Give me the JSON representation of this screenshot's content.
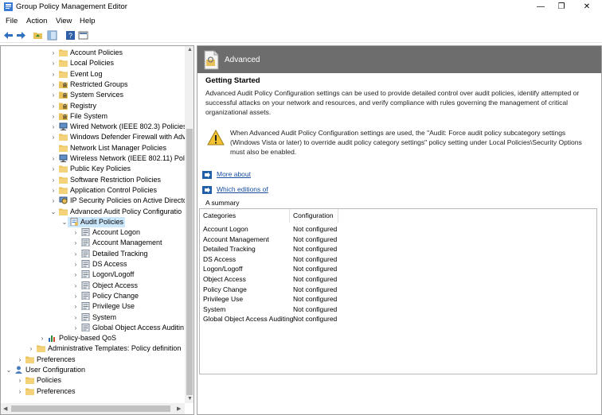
{
  "window": {
    "title": "Group Policy Management Editor"
  },
  "menu": [
    "File",
    "Action",
    "View",
    "Help"
  ],
  "tree": [
    {
      "label": "Account Policies",
      "level": 4,
      "icon": "folder-icon",
      "expander": "collapsed"
    },
    {
      "label": "Local Policies",
      "level": 4,
      "icon": "folder-icon",
      "expander": "collapsed"
    },
    {
      "label": "Event Log",
      "level": 4,
      "icon": "folder-icon",
      "expander": "collapsed"
    },
    {
      "label": "Restricted Groups",
      "level": 4,
      "icon": "folder-lock-icon",
      "expander": "collapsed"
    },
    {
      "label": "System Services",
      "level": 4,
      "icon": "folder-lock-icon",
      "expander": "collapsed"
    },
    {
      "label": "Registry",
      "level": 4,
      "icon": "folder-lock-icon",
      "expander": "collapsed"
    },
    {
      "label": "File System",
      "level": 4,
      "icon": "folder-lock-icon",
      "expander": "collapsed"
    },
    {
      "label": "Wired Network (IEEE 802.3) Policies",
      "level": 4,
      "icon": "network-icon",
      "expander": "collapsed"
    },
    {
      "label": "Windows Defender Firewall with Adv",
      "level": 4,
      "icon": "folder-icon",
      "expander": "collapsed"
    },
    {
      "label": "Network List Manager Policies",
      "level": 4,
      "icon": "folder-icon",
      "expander": "none"
    },
    {
      "label": "Wireless Network (IEEE 802.11) Polici",
      "level": 4,
      "icon": "network-icon",
      "expander": "collapsed"
    },
    {
      "label": "Public Key Policies",
      "level": 4,
      "icon": "folder-icon",
      "expander": "collapsed"
    },
    {
      "label": "Software Restriction Policies",
      "level": 4,
      "icon": "folder-icon",
      "expander": "collapsed"
    },
    {
      "label": "Application Control Policies",
      "level": 4,
      "icon": "folder-icon",
      "expander": "collapsed"
    },
    {
      "label": "IP Security Policies on Active Directo",
      "level": 4,
      "icon": "ip-security-icon",
      "expander": "collapsed"
    },
    {
      "label": "Advanced Audit Policy Configuratio",
      "level": 4,
      "icon": "folder-icon",
      "expander": "expanded"
    },
    {
      "label": "Audit Policies",
      "level": 5,
      "icon": "audit-icon",
      "expander": "expanded",
      "selected": true
    },
    {
      "label": "Account Logon",
      "level": 6,
      "icon": "policy-icon",
      "expander": "collapsed"
    },
    {
      "label": "Account Management",
      "level": 6,
      "icon": "policy-icon",
      "expander": "collapsed"
    },
    {
      "label": "Detailed Tracking",
      "level": 6,
      "icon": "policy-icon",
      "expander": "collapsed"
    },
    {
      "label": "DS Access",
      "level": 6,
      "icon": "policy-icon",
      "expander": "collapsed"
    },
    {
      "label": "Logon/Logoff",
      "level": 6,
      "icon": "policy-icon",
      "expander": "collapsed"
    },
    {
      "label": "Object Access",
      "level": 6,
      "icon": "policy-icon",
      "expander": "collapsed"
    },
    {
      "label": "Policy Change",
      "level": 6,
      "icon": "policy-icon",
      "expander": "collapsed"
    },
    {
      "label": "Privilege Use",
      "level": 6,
      "icon": "policy-icon",
      "expander": "collapsed"
    },
    {
      "label": "System",
      "level": 6,
      "icon": "policy-icon",
      "expander": "collapsed"
    },
    {
      "label": "Global Object Access Auditin",
      "level": 6,
      "icon": "policy-icon",
      "expander": "collapsed"
    },
    {
      "label": "Policy-based QoS",
      "level": 3,
      "icon": "chart-icon",
      "expander": "collapsed"
    },
    {
      "label": "Administrative Templates: Policy definition",
      "level": 2,
      "icon": "folder-icon",
      "expander": "collapsed"
    },
    {
      "label": "Preferences",
      "level": 1,
      "icon": "folder-icon",
      "expander": "collapsed"
    },
    {
      "label": "User Configuration",
      "level": 0,
      "icon": "user-config-icon",
      "expander": "expanded"
    },
    {
      "label": "Policies",
      "level": 1,
      "icon": "folder-icon",
      "expander": "collapsed"
    },
    {
      "label": "Preferences",
      "level": 1,
      "icon": "folder-icon",
      "expander": "collapsed"
    }
  ],
  "details": {
    "header": "Advanced",
    "section_title": "Getting Started",
    "description": "Advanced Audit Policy Configuration settings can be used to provide detailed control over audit policies, identify attempted or successful attacks on your network and resources, and verify compliance with rules governing the management of critical organizational assets.",
    "warning": "When Advanced Audit Policy Configuration settings are used, the \"Audit: Force audit policy subcategory settings (Windows Vista or later) to override audit policy category settings\" policy setting under Local Policies\\Security Options must also be enabled.",
    "link_about": "More about",
    "link_editions": "Which editions of",
    "summary_label": "A summary",
    "table": {
      "headers": [
        "Categories",
        "Configuration"
      ],
      "rows": [
        [
          "Account Logon",
          "Not configured"
        ],
        [
          "Account Management",
          "Not configured"
        ],
        [
          "Detailed Tracking",
          "Not configured"
        ],
        [
          "DS Access",
          "Not configured"
        ],
        [
          "Logon/Logoff",
          "Not configured"
        ],
        [
          "Object Access",
          "Not configured"
        ],
        [
          "Policy Change",
          "Not configured"
        ],
        [
          "Privilege Use",
          "Not configured"
        ],
        [
          "System",
          "Not configured"
        ],
        [
          "Global Object Access Auditing",
          "Not configured"
        ]
      ]
    }
  },
  "colors": {
    "header_band": "#6d6d6d",
    "selection": "#cce8ff",
    "link": "#1a4fa0",
    "folder": "#e8c15a",
    "warning": "#f2c230"
  }
}
